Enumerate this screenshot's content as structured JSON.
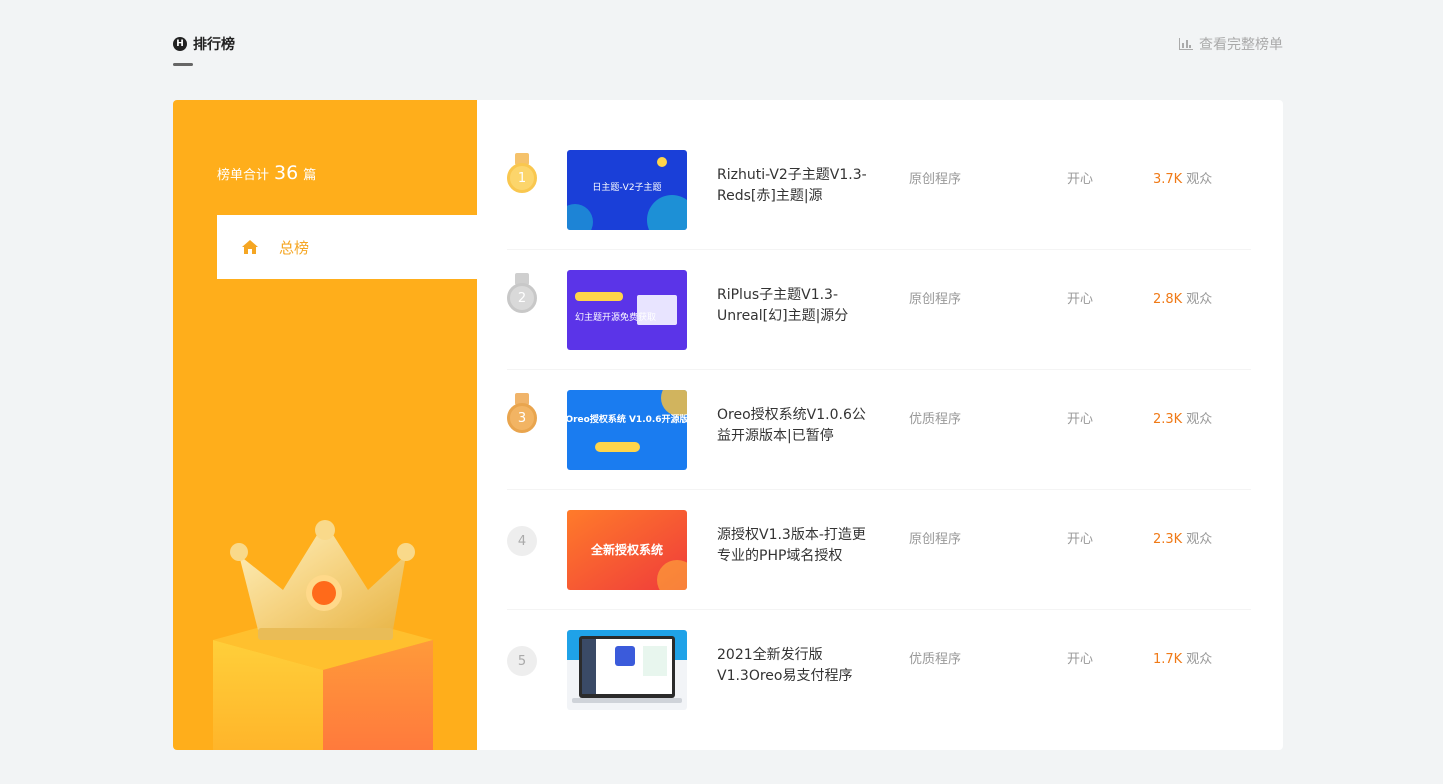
{
  "header": {
    "title": "排行榜",
    "title_icon": "logo-icon",
    "full_link": "查看完整榜单"
  },
  "sidebar": {
    "total_prefix": "榜单合计",
    "total_count": "36",
    "total_suffix": "篇",
    "tab_label": "总榜"
  },
  "colors": {
    "sidebar_bg": "#ffae1b",
    "accent": "#f5a623",
    "view_number": "#f07a17"
  },
  "rankings": [
    {
      "rank": "1",
      "medal": "gold",
      "title": "Rizhuti-V2子主题V1.3-Reds[赤]主题|源",
      "category": "原创程序",
      "author": "开心",
      "views": "3.7K",
      "views_unit": "观众",
      "thumb_text": "日主题-V2子主题"
    },
    {
      "rank": "2",
      "medal": "silver",
      "title": "RiPlus子主题V1.3-Unreal[幻]主题|源分",
      "category": "原创程序",
      "author": "开心",
      "views": "2.8K",
      "views_unit": "观众",
      "thumb_text": "幻主题开源免费获取"
    },
    {
      "rank": "3",
      "medal": "bronze",
      "title": "Oreo授权系统V1.0.6公益开源版本|已暂停",
      "category": "优质程序",
      "author": "开心",
      "views": "2.3K",
      "views_unit": "观众",
      "thumb_text": "Oreo授权系统 V1.0.6开源版"
    },
    {
      "rank": "4",
      "medal": "",
      "title": "源授权V1.3版本-打造更专业的PHP域名授权",
      "category": "原创程序",
      "author": "开心",
      "views": "2.3K",
      "views_unit": "观众",
      "thumb_text": "全新授权系统"
    },
    {
      "rank": "5",
      "medal": "",
      "title": "2021全新发行版V1.3Oreo易支付程序",
      "category": "优质程序",
      "author": "开心",
      "views": "1.7K",
      "views_unit": "观众",
      "thumb_text": ""
    }
  ]
}
